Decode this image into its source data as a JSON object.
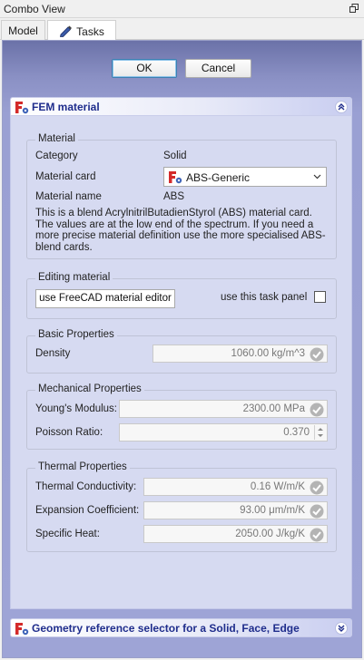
{
  "window": {
    "title": "Combo View"
  },
  "tabs": {
    "model": "Model",
    "tasks": "Tasks"
  },
  "actions": {
    "ok": "OK",
    "cancel": "Cancel"
  },
  "fem_panel": {
    "title": "FEM material",
    "material": {
      "group_title": "Material",
      "category_label": "Category",
      "category_value": "Solid",
      "card_label": "Material card",
      "card_value": "ABS-Generic",
      "name_label": "Material name",
      "name_value": "ABS",
      "description": "This is a blend AcrylnitrilButadienStyrol (ABS) material card. The values are at the low end of the spectrum. If you need a more precise material definition use the more specialised ABS-blend cards."
    },
    "editing": {
      "group_title": "Editing material",
      "editor_button": "use FreeCAD material editor",
      "task_panel_label": "use this task panel"
    },
    "basic": {
      "group_title": "Basic Properties",
      "density_label": "Density",
      "density_value": "1060.00 kg/m^3"
    },
    "mechanical": {
      "group_title": "Mechanical Properties",
      "youngs_label": "Young's Modulus:",
      "youngs_value": "2300.00 MPa",
      "poisson_label": "Poisson Ratio:",
      "poisson_value": "0.370"
    },
    "thermal": {
      "group_title": "Thermal  Properties",
      "conductivity_label": "Thermal Conductivity:",
      "conductivity_value": "0.16 W/m/K",
      "expansion_label": "Expansion Coefficient:",
      "expansion_value": "93.00 μm/m/K",
      "specific_heat_label": "Specific Heat:",
      "specific_heat_value": "2050.00 J/kg/K"
    }
  },
  "geometry_panel": {
    "title": "Geometry reference selector for a Solid, Face, Edge"
  },
  "icons": {
    "float": "float-window-icon",
    "tasks": "pencil-icon",
    "fem": "fem-material-icon",
    "collapse": "chevron-up-double-icon",
    "expand": "chevron-down-double-icon",
    "valid": "checkmark-icon"
  },
  "colors": {
    "panel_title": "#1f2d8c",
    "accent": "#3c7fb1",
    "panel_bg": "#d6daf1"
  }
}
